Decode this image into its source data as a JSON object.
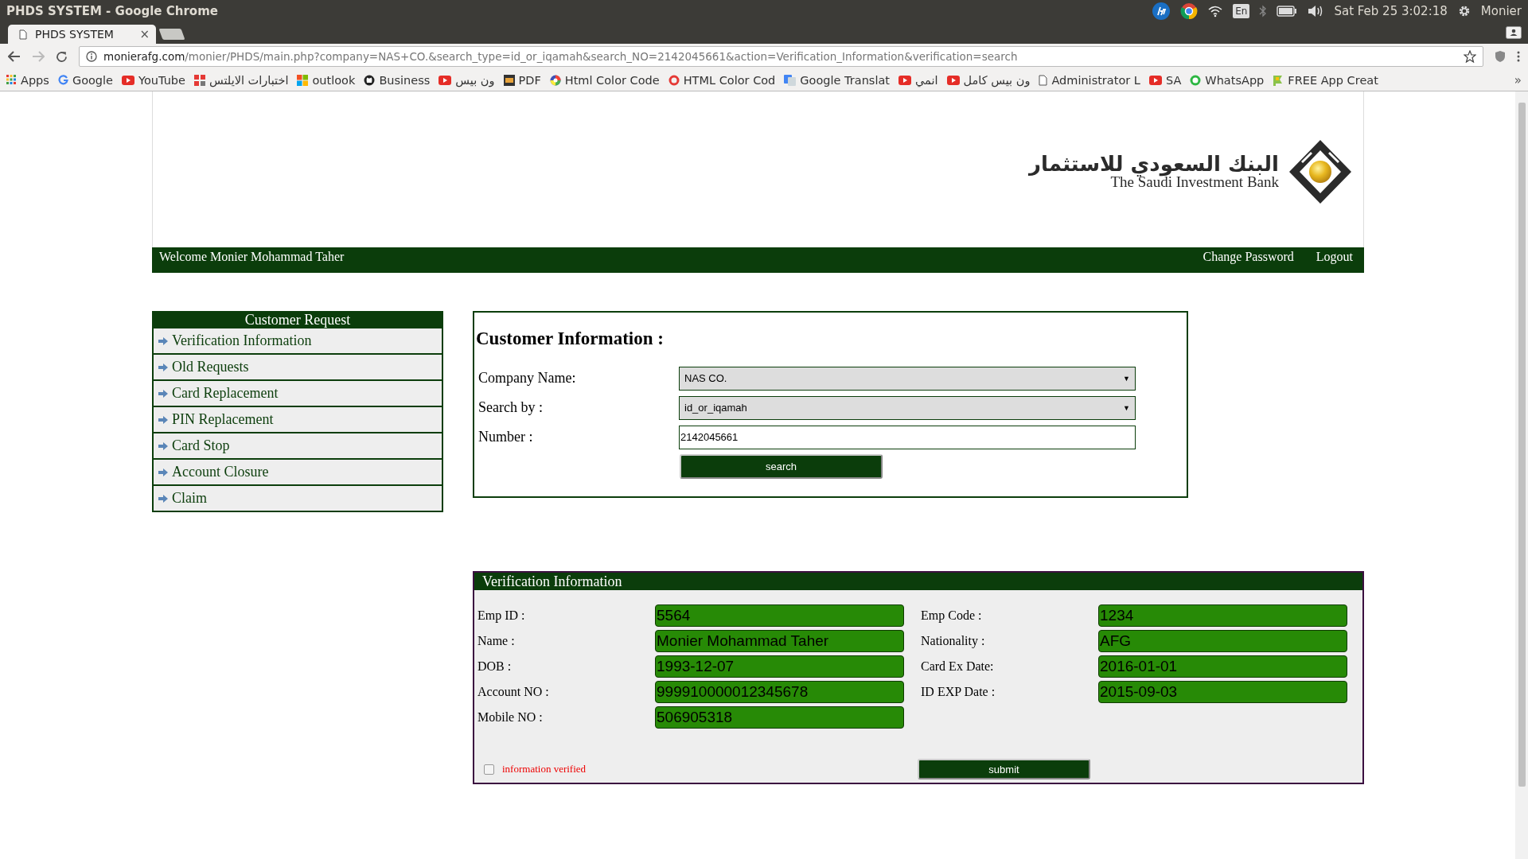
{
  "system_bar": {
    "window_title": "PHDS SYSTEM - Google Chrome",
    "keyboard": "En",
    "clock": "Sat Feb 25  3:02:18",
    "user": "Monier"
  },
  "browser": {
    "tabs": [
      {
        "title": "PHDS SYSTEM",
        "selected": true
      }
    ],
    "close_glyph": "×",
    "url": {
      "domain": "monierafg.com",
      "path": "/monier/PHDS/main.php?company=NAS+CO.&search_type=id_or_iqamah&search_NO=2142045661&action=Verification_Information&verification=search"
    },
    "bookmarks": [
      {
        "label": "Apps",
        "kind": "apps"
      },
      {
        "label": "Google",
        "kind": "google"
      },
      {
        "label": "YouTube",
        "kind": "video"
      },
      {
        "label": "اختبارات الايلتس",
        "kind": "tiles"
      },
      {
        "label": "outlook",
        "kind": "windows"
      },
      {
        "label": "Business",
        "kind": "github"
      },
      {
        "label": "ون بيس",
        "kind": "video"
      },
      {
        "label": "PDF",
        "kind": "pdf"
      },
      {
        "label": "Html Color Code",
        "kind": "wheel"
      },
      {
        "label": "HTML Color Cod",
        "kind": "ring"
      },
      {
        "label": "Google Translat",
        "kind": "translate"
      },
      {
        "label": "انمي",
        "kind": "video"
      },
      {
        "label": "ون بيس كامل",
        "kind": "video"
      },
      {
        "label": "Administrator L",
        "kind": "file"
      },
      {
        "label": "SA",
        "kind": "video"
      },
      {
        "label": "WhatsApp",
        "kind": "chat"
      },
      {
        "label": "FREE App Creat",
        "kind": "flag"
      }
    ],
    "more_glyph": "»"
  },
  "header": {
    "logo_arabic": "البنك السعودي للاستثمار",
    "logo_english": "The Saudi Investment Bank",
    "welcome": "Welcome Monier Mohammad Taher",
    "links": [
      "Change Password",
      "Logout"
    ]
  },
  "sidebar": {
    "title": "Customer Request",
    "items": [
      {
        "label": "Verification Information"
      },
      {
        "label": "Old Requests"
      },
      {
        "label": "Card Replacement"
      },
      {
        "label": "PIN Replacement"
      },
      {
        "label": "Card Stop"
      },
      {
        "label": "Account Closure"
      },
      {
        "label": "Claim"
      }
    ]
  },
  "customer_form": {
    "title": "Customer Information :",
    "company": {
      "label": "Company Name:",
      "value": "NAS CO."
    },
    "search_by": {
      "label": "Search by :",
      "value": "id_or_iqamah"
    },
    "number": {
      "label": "Number :",
      "value": "2142045661"
    },
    "button": "search",
    "select_glyph": "▼"
  },
  "verification": {
    "title": "Verification Information",
    "fields": [
      {
        "label": "Emp ID :",
        "value": "5564"
      },
      {
        "label": "Emp Code :",
        "value": "1234"
      },
      {
        "label": "Name :",
        "value": "Monier Mohammad Taher"
      },
      {
        "label": "Nationality :",
        "value": "AFG"
      },
      {
        "label": "DOB :",
        "value": "1993-12-07"
      },
      {
        "label": "Card Ex Date:",
        "value": "2016-01-01"
      },
      {
        "label": "Account NO :",
        "value": "999910000012345678"
      },
      {
        "label": "ID EXP Date :",
        "value": "2015-09-03"
      },
      {
        "label": "Mobile NO :",
        "value": "506905318"
      }
    ],
    "verified": {
      "label": "information verified",
      "checked": false
    },
    "button": "submit"
  }
}
